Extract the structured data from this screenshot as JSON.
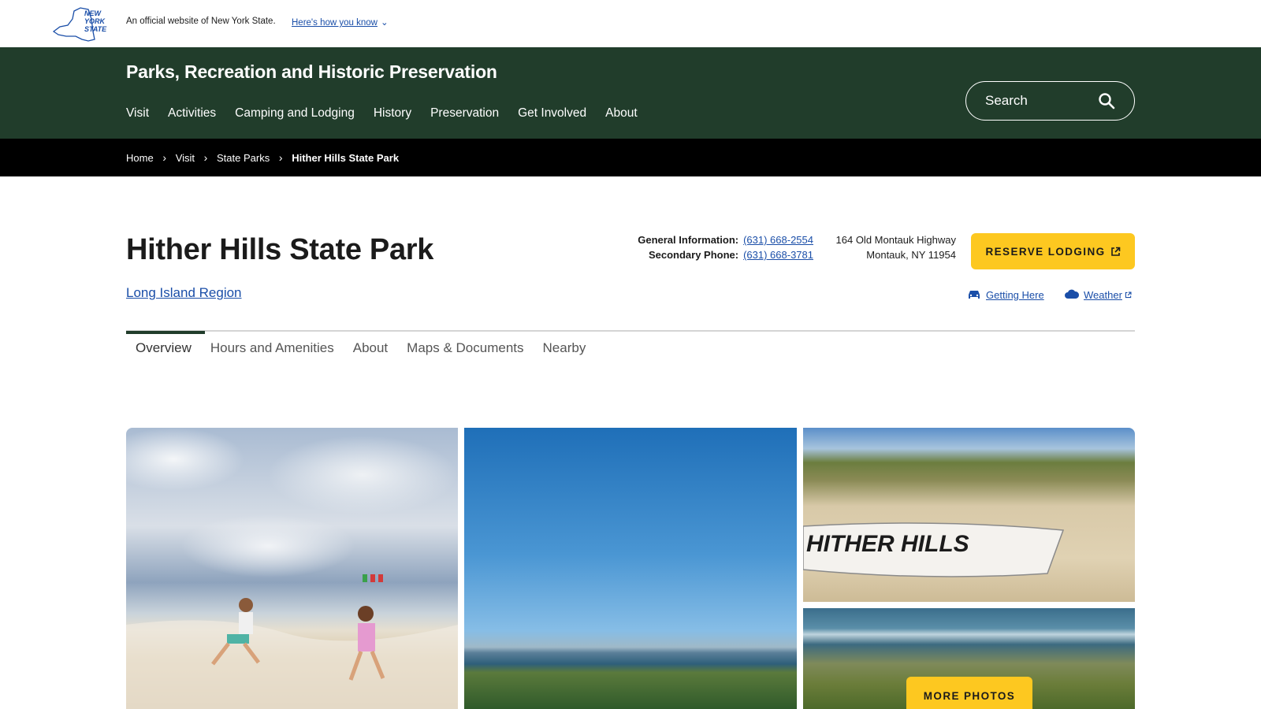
{
  "official_banner": {
    "logo_text": [
      "NEW",
      "YORK",
      "STATE"
    ],
    "official_text": "An official website of New York State.",
    "how_know_link": "Here's how you know"
  },
  "header": {
    "agency_title": "Parks, Recreation and Historic Preservation",
    "nav": [
      "Visit",
      "Activities",
      "Camping and Lodging",
      "History",
      "Preservation",
      "Get Involved",
      "About"
    ],
    "search_placeholder": "Search"
  },
  "breadcrumb": [
    "Home",
    "Visit",
    "State Parks",
    "Hither Hills State Park"
  ],
  "park": {
    "title": "Hither Hills State Park",
    "region": "Long Island Region",
    "general_info_label": "General Information:",
    "general_info_phone": "(631) 668-2554",
    "secondary_phone_label": "Secondary Phone:",
    "secondary_phone": "(631) 668-3781",
    "address_line1": "164 Old Montauk Highway",
    "address_line2": "Montauk, NY 11954",
    "reserve_label": "RESERVE LODGING",
    "getting_here": "Getting Here",
    "weather": "Weather"
  },
  "tabs": [
    "Overview",
    "Hours and Amenities",
    "About",
    "Maps & Documents",
    "Nearby"
  ],
  "active_tab": "Overview",
  "gallery": {
    "boat_text": "HITHER HILLS",
    "more_photos": "MORE PHOTOS"
  },
  "colors": {
    "header_green": "#213d2b",
    "link_blue": "#1a4ea8",
    "accent_yellow": "#fdc820"
  }
}
